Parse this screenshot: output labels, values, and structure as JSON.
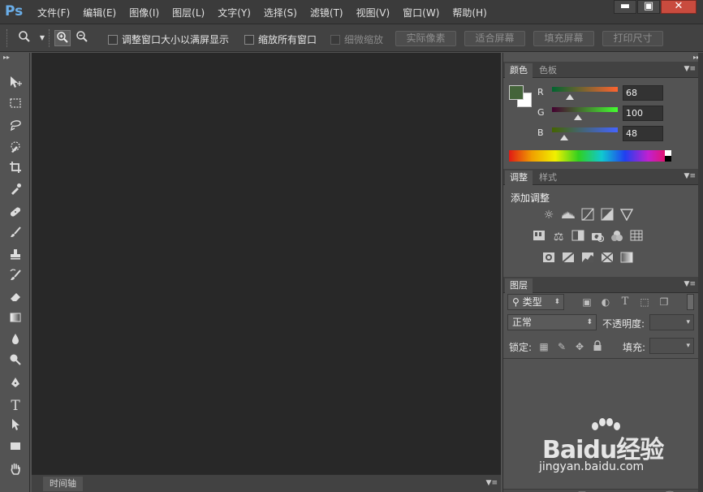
{
  "app": {
    "logo": "Ps",
    "menus": [
      "文件(F)",
      "编辑(E)",
      "图像(I)",
      "图层(L)",
      "文字(Y)",
      "选择(S)",
      "滤镜(T)",
      "视图(V)",
      "窗口(W)",
      "帮助(H)"
    ],
    "window_buttons": {
      "minimize": "▬",
      "maximize": "▣",
      "close": "✕"
    }
  },
  "options_bar": {
    "tool_icon": "zoom-icon",
    "zoom_in_icon": "zoom-in-icon",
    "zoom_out_icon": "zoom-out-icon",
    "checkbox_resize": "调整窗口大小以满屏显示",
    "checkbox_zoom_all": "缩放所有窗口",
    "checkbox_scrubby": "细微缩放",
    "btn_actual_pixels": "实际像素",
    "btn_fit_screen": "适合屏幕",
    "btn_fill_screen": "填充屏幕",
    "btn_print_size": "打印尺寸"
  },
  "timeline": {
    "tab_label": "时间轴"
  },
  "color_panel": {
    "tabs": [
      "颜色",
      "色板"
    ],
    "foreground": "#44643a",
    "background": "#ffffff",
    "channels": [
      {
        "label": "R",
        "value": "68",
        "fraction": 0.267
      },
      {
        "label": "G",
        "value": "100",
        "fraction": 0.392
      },
      {
        "label": "B",
        "value": "48",
        "fraction": 0.188
      }
    ]
  },
  "adjustments_panel": {
    "tabs": [
      "调整",
      "样式"
    ],
    "title": "添加调整"
  },
  "layers_panel": {
    "tab": "图层",
    "filter_kind": "类型",
    "blend_mode": "正常",
    "opacity_label": "不透明度:",
    "lock_label": "锁定:",
    "fill_label": "填充:"
  },
  "watermark": {
    "brand": "Baidu经验",
    "url": "jingyan.baidu.com"
  }
}
